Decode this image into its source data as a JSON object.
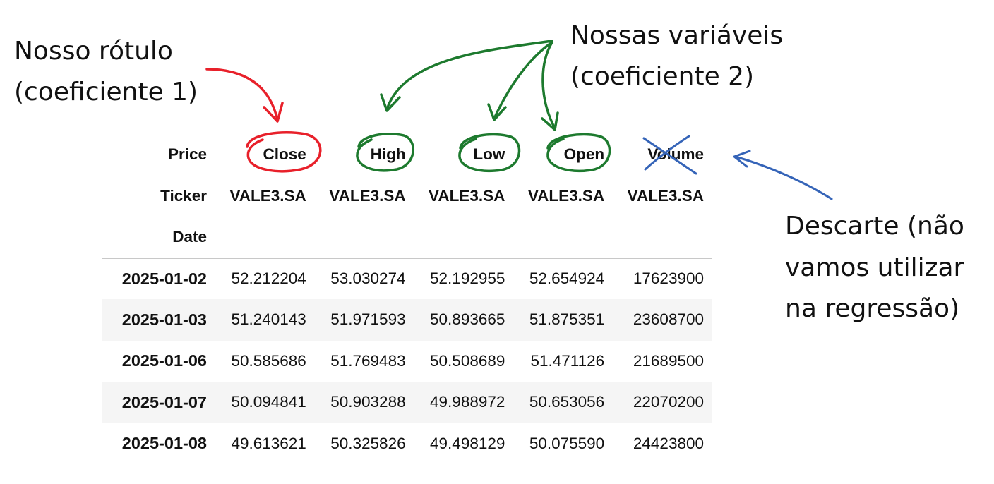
{
  "annotations": {
    "label_note": {
      "line1": "Nosso rótulo",
      "line2": "(coeficiente 1)"
    },
    "features_note": {
      "line1": "Nossas variáveis",
      "line2": "(coeficiente 2)"
    },
    "discard_note": {
      "line1": "Descarte (não",
      "line2": "vamos utilizar",
      "line3": "na regressão)"
    },
    "colors": {
      "label": "#e8202a",
      "features": "#1d7a2e",
      "discard": "#3564b8"
    }
  },
  "table": {
    "price_header": "Price",
    "ticker_header": "Ticker",
    "date_header": "Date",
    "columns": [
      "Close",
      "High",
      "Low",
      "Open",
      "Volume"
    ],
    "tickers": [
      "VALE3.SA",
      "VALE3.SA",
      "VALE3.SA",
      "VALE3.SA",
      "VALE3.SA"
    ],
    "rows": [
      {
        "date": "2025-01-02",
        "values": [
          "52.212204",
          "53.030274",
          "52.192955",
          "52.654924",
          "17623900"
        ]
      },
      {
        "date": "2025-01-03",
        "values": [
          "51.240143",
          "51.971593",
          "50.893665",
          "51.875351",
          "23608700"
        ]
      },
      {
        "date": "2025-01-06",
        "values": [
          "50.585686",
          "51.769483",
          "50.508689",
          "51.471126",
          "21689500"
        ]
      },
      {
        "date": "2025-01-07",
        "values": [
          "50.094841",
          "50.903288",
          "49.988972",
          "50.653056",
          "22070200"
        ]
      },
      {
        "date": "2025-01-08",
        "values": [
          "49.613621",
          "50.325826",
          "49.498129",
          "50.075590",
          "24423800"
        ]
      }
    ]
  }
}
